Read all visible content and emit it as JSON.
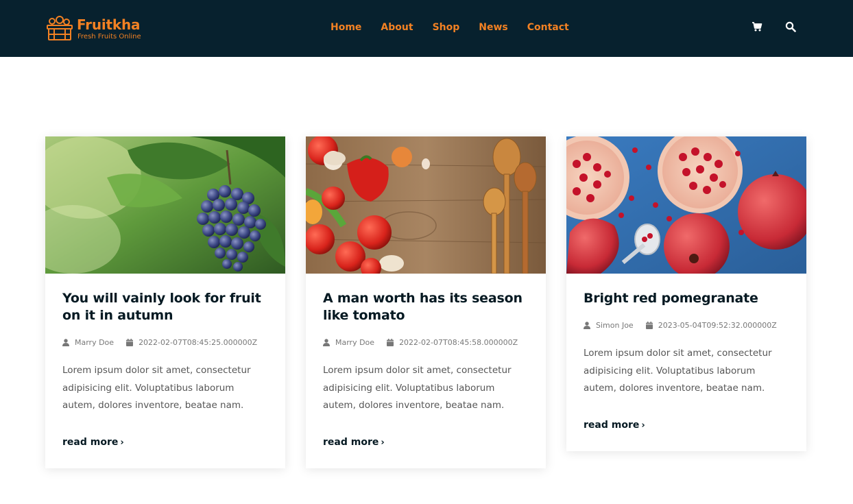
{
  "header": {
    "brand_name": "Fruitkha",
    "brand_tagline": "Fresh Fruits Online",
    "nav": [
      {
        "label": "Home"
      },
      {
        "label": "About"
      },
      {
        "label": "Shop"
      },
      {
        "label": "News"
      },
      {
        "label": "Contact"
      }
    ],
    "icons": [
      "cart-icon",
      "search-icon"
    ]
  },
  "colors": {
    "header_bg": "#07212e",
    "accent": "#f28123",
    "heading": "#051922"
  },
  "posts": [
    {
      "title": "You will vainly look for fruit on it in autumn",
      "author": "Marry Doe",
      "date": "2022-02-07T08:45:25.000000Z",
      "excerpt": "Lorem ipsum dolor sit amet, consectetur adipisicing elit. Voluptatibus laborum autem, dolores inventore, beatae nam.",
      "read_more": "read more",
      "image": "grapes-vineyard-photo"
    },
    {
      "title": "A man worth has its season like tomato",
      "author": "Marry Doe",
      "date": "2022-02-07T08:45:58.000000Z",
      "excerpt": "Lorem ipsum dolor sit amet, consectetur adipisicing elit. Voluptatibus laborum autem, dolores inventore, beatae nam.",
      "read_more": "read more",
      "image": "vegetables-wooden-spoons-photo"
    },
    {
      "title": "Bright red pomegranate",
      "author": "Simon Joe",
      "date": "2023-05-04T09:52:32.000000Z",
      "excerpt": "Lorem ipsum dolor sit amet, consectetur adipisicing elit. Voluptatibus laborum autem, dolores inventore, beatae nam.",
      "read_more": "read more",
      "image": "pomegranate-photo"
    }
  ]
}
